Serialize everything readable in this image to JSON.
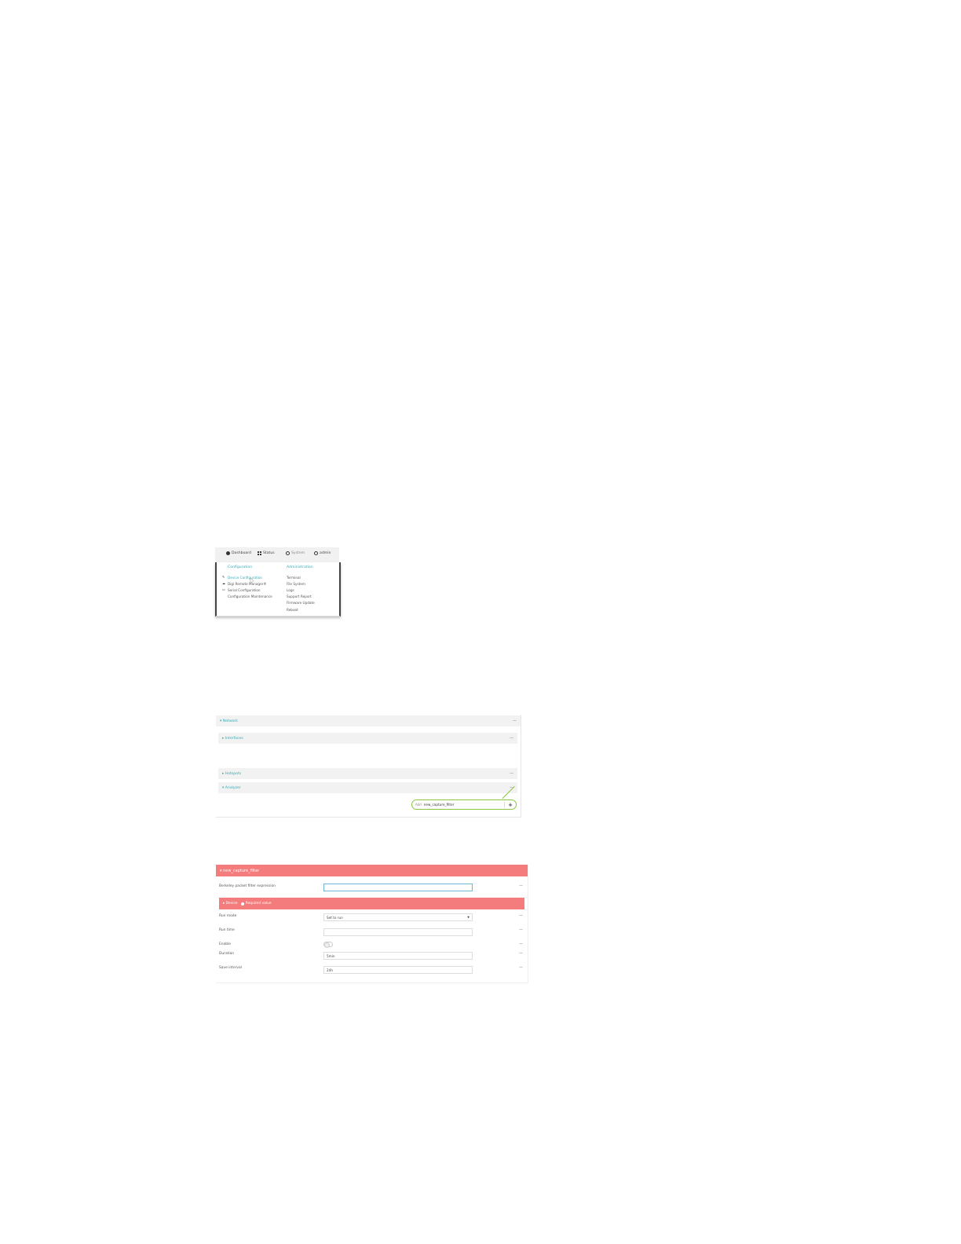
{
  "nav": {
    "items": [
      {
        "label": "Dashboard",
        "icon": "dashboard-icon"
      },
      {
        "label": "Status",
        "icon": "grid-icon"
      },
      {
        "label": "System",
        "icon": "gear-icon"
      },
      {
        "label": "admin",
        "icon": "user-icon"
      }
    ],
    "config_head": "Configuration",
    "config_items": [
      "Device Configuration",
      "Digi Remote Manager®",
      "Serial Configuration",
      "Configuration Maintenance"
    ],
    "admin_head": "Administration",
    "admin_items": [
      "Terminal",
      "File System",
      "Logs",
      "Support Report",
      "Firmware Update",
      "Reboot"
    ]
  },
  "tree": {
    "network": "▾ Network",
    "interfaces": "▸ Interfaces",
    "hotspots": "▸ Hotspots",
    "analyzer": "▾ Analyzer",
    "dash": "—",
    "add_label": "Add",
    "add_value": "new_capture_filter",
    "add_button": "+"
  },
  "form": {
    "title": "▾ new_capture_filter",
    "bpf_label": "Berkeley packet filter expression",
    "device_label": "▸ Device",
    "required_label": "Required value",
    "run_mode_label": "Run mode",
    "run_mode_value": "Set to run",
    "run_time_label": "Run time",
    "enable_label": "Enable",
    "duration_label": "Duration",
    "duration_value": "5min",
    "save_interval_label": "Save interval",
    "save_interval_value": "24h",
    "dash": "—",
    "caret": "▼"
  }
}
